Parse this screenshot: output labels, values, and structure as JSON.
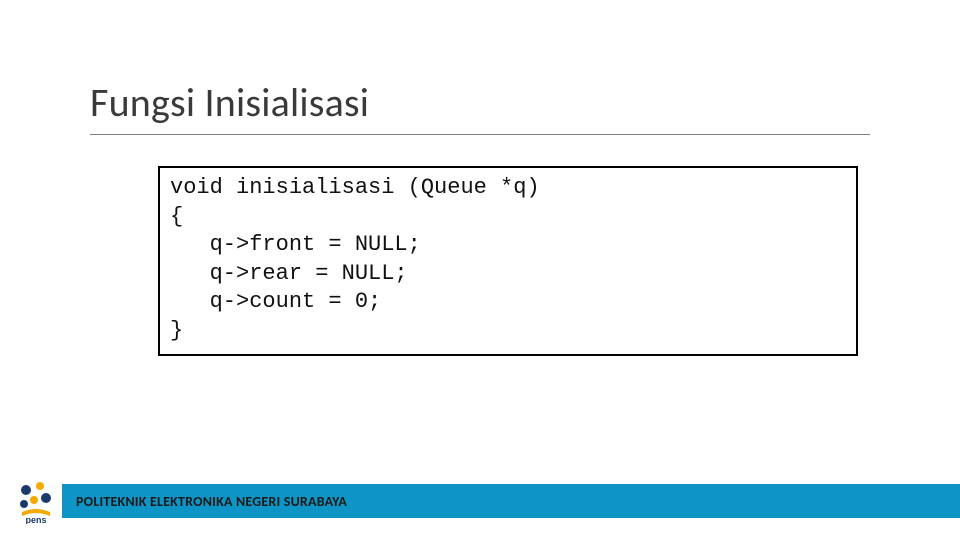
{
  "title": "Fungsi Inisialisasi",
  "code": {
    "l1": "void inisialisasi (Queue *q)",
    "l2": "{",
    "l3": "   q->front = NULL;",
    "l4": "   q->rear = NULL;",
    "l5": "   q->count = 0;",
    "l6": "}"
  },
  "footer": "POLITEKNIK ELEKTRONIKA NEGERI SURABAYA",
  "logo_label": "pens"
}
